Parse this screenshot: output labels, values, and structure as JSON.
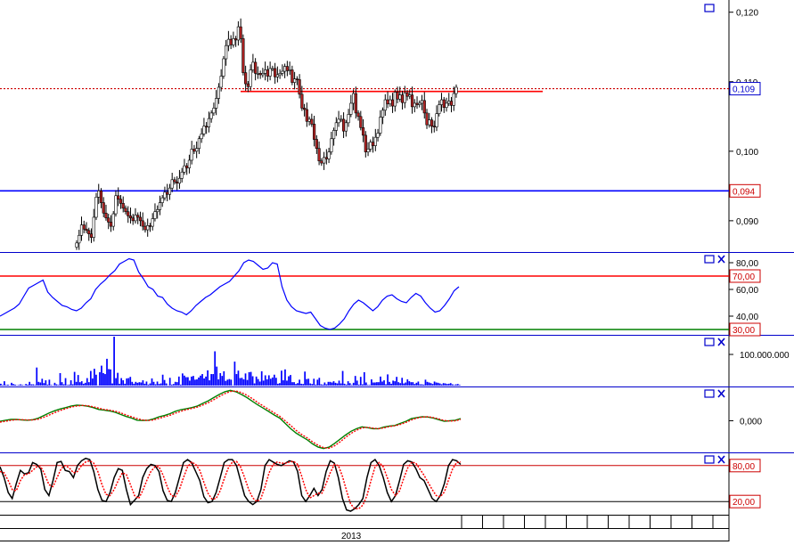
{
  "chart_data": [
    {
      "type": "candlestick",
      "panel": "price",
      "y_ticks": [
        "0,120",
        "0,110",
        "0,100",
        "0,090"
      ],
      "ylim": [
        0.0855,
        0.1215
      ],
      "current_price_label": "0,109",
      "current_price": 0.109,
      "support_label": "0,094",
      "support_level": 0.0943,
      "resistance_level": 0.1086,
      "colors": {
        "up": "#ffffff",
        "down": "#b22222",
        "support": "#0000ff",
        "resistance": "#ff0000",
        "current": "#cc0000"
      },
      "closes": [
        0.0868,
        0.0879,
        0.0894,
        0.0888,
        0.0886,
        0.0881,
        0.0876,
        0.0905,
        0.0934,
        0.0943,
        0.0926,
        0.0911,
        0.0904,
        0.0898,
        0.0892,
        0.091,
        0.0936,
        0.0931,
        0.0925,
        0.0918,
        0.0913,
        0.0907,
        0.0904,
        0.09,
        0.0908,
        0.0905,
        0.09,
        0.0892,
        0.0887,
        0.0893,
        0.0892,
        0.0903,
        0.0913,
        0.0916,
        0.0926,
        0.0933,
        0.0941,
        0.0938,
        0.0947,
        0.0959,
        0.0956,
        0.0954,
        0.0961,
        0.097,
        0.0979,
        0.0976,
        0.0987,
        0.1003,
        0.1,
        0.1004,
        0.1018,
        0.1025,
        0.1036,
        0.1035,
        0.1047,
        0.1055,
        0.1062,
        0.1076,
        0.1092,
        0.1108,
        0.1133,
        0.1152,
        0.1161,
        0.1153,
        0.1162,
        0.116,
        0.1179,
        0.1162,
        0.1113,
        0.1097,
        0.1093,
        0.1117,
        0.1128,
        0.1112,
        0.1112,
        0.111,
        0.1112,
        0.1117,
        0.1108,
        0.1119,
        0.1119,
        0.1107,
        0.111,
        0.1112,
        0.1115,
        0.1122,
        0.1116,
        0.1117,
        0.1099,
        0.1104,
        0.1103,
        0.1082,
        0.1062,
        0.106,
        0.1043,
        0.1046,
        0.1039,
        0.1017,
        0.1004,
        0.0986,
        0.0983,
        0.0991,
        0.0989,
        0.0999,
        0.1018,
        0.103,
        0.1041,
        0.1046,
        0.1046,
        0.1029,
        0.1041,
        0.1053,
        0.1069,
        0.1083,
        0.1055,
        0.105,
        0.1034,
        0.1023,
        0.0999,
        0.1003,
        0.1013,
        0.1008,
        0.102,
        0.1026,
        0.1049,
        0.1059,
        0.1074,
        0.1068,
        0.1074,
        0.1065,
        0.1085,
        0.1075,
        0.1081,
        0.107,
        0.1084,
        0.1079,
        0.1081,
        0.1064,
        0.1069,
        0.1067,
        0.1069,
        0.1073,
        0.1055,
        0.1038,
        0.1045,
        0.1036,
        0.1035,
        0.1054,
        0.1067,
        0.1074,
        0.1063,
        0.1069,
        0.1072,
        0.1066,
        0.1083,
        0.1092
      ]
    },
    {
      "type": "line",
      "panel": "rsi",
      "y_ticks": [
        "80,00",
        "60,00",
        "40,00"
      ],
      "ylim": [
        26,
        88
      ],
      "upper_label": "70,00",
      "upper_level": 70,
      "lower_label": "30,00",
      "lower_level": 30,
      "values": [
        40,
        42,
        44,
        46,
        49,
        55,
        61,
        63,
        65,
        67,
        58,
        54,
        51,
        48,
        47,
        45,
        44,
        46,
        50,
        53,
        60,
        64,
        67,
        71,
        74,
        79,
        81,
        83,
        82,
        73,
        68,
        62,
        60,
        55,
        54,
        49,
        46,
        44,
        43,
        41,
        44,
        48,
        51,
        54,
        56,
        59,
        62,
        64,
        66,
        70,
        74,
        80,
        82,
        81,
        78,
        75,
        76,
        80,
        79,
        62,
        52,
        47,
        44,
        43,
        42,
        43,
        38,
        33,
        31,
        30,
        31,
        34,
        38,
        44,
        49,
        52,
        50,
        47,
        44,
        47,
        52,
        55,
        56,
        53,
        51,
        50,
        54,
        57,
        55,
        50,
        46,
        43,
        44,
        48,
        53,
        59,
        62
      ],
      "colors": {
        "line": "#0000ff",
        "upper": "#ff0000",
        "lower": "#008000"
      }
    },
    {
      "type": "bar",
      "panel": "volume",
      "y_ticks": [
        "100.000.000"
      ],
      "ylim": [
        0,
        160000000
      ],
      "values": [
        6000000,
        2000000,
        14000000,
        2000000,
        3000000,
        1000000,
        9000000,
        5000000,
        3000000,
        1000000,
        2000000,
        4000000,
        2000000,
        1000000,
        5000000,
        3000000,
        12000000,
        4000000,
        4000000,
        2000000,
        58000000,
        12000000,
        10000000,
        22000000,
        8000000,
        17000000,
        3000000,
        19000000,
        2000000,
        1000000,
        9000000,
        4000000,
        2000000,
        40000000,
        11000000,
        4000000,
        24000000,
        2000000,
        3000000,
        17000000,
        4000000,
        44000000,
        12000000,
        34000000,
        11000000,
        14000000,
        6000000,
        9000000,
        24000000,
        11000000,
        47000000,
        23000000,
        54000000,
        35000000,
        1000000,
        43000000,
        64000000,
        40000000,
        37000000,
        86000000,
        53000000,
        52000000,
        7000000,
        157000000,
        24000000,
        41000000,
        6000000,
        24000000,
        17000000,
        6000000,
        23000000,
        24000000,
        28000000,
        12000000,
        6000000,
        12000000,
        9000000,
        11000000,
        10000000,
        17000000,
        6000000,
        13000000,
        3000000,
        7000000,
        23000000,
        12000000,
        4000000,
        13000000,
        5000000,
        7000000,
        35000000,
        18000000,
        7000000,
        1000000,
        25000000,
        3000000,
        5000000,
        12000000,
        11000000,
        29000000,
        3000000,
        39000000,
        32000000,
        27000000,
        27000000,
        16000000,
        29000000,
        31000000,
        19000000,
        20000000,
        26000000,
        32000000,
        37000000,
        23000000,
        29000000,
        49000000,
        17000000,
        37000000,
        37000000,
        110000000,
        61000000,
        20000000,
        40000000,
        31000000,
        46000000,
        15000000,
        19000000,
        21000000,
        19000000,
        1000000,
        77000000,
        37000000,
        48000000,
        24000000,
        25000000,
        20000000,
        39000000,
        18000000,
        43000000,
        44000000,
        30000000,
        7000000,
        29000000,
        21000000,
        13000000,
        46000000,
        16000000,
        33000000,
        20000000,
        33000000,
        22000000,
        26000000,
        35000000,
        25000000,
        6000000,
        8000000,
        48000000,
        17000000,
        52000000,
        16000000,
        30000000,
        34000000,
        11000000,
        11000000,
        5000000,
        8000000,
        19000000,
        6000000,
        5000000,
        45000000,
        21000000,
        22000000,
        7000000,
        5000000,
        22000000,
        3000000,
        19000000,
        25000000,
        4000000,
        3000000,
        10000000,
        4000000,
        12000000,
        12000000,
        10000000,
        14000000,
        9000000,
        7000000,
        16000000,
        7000000,
        47000000,
        6000000,
        3000000,
        14000000,
        8000000,
        2000000,
        9000000,
        31000000,
        16000000,
        3000000,
        28000000,
        4000000,
        43000000,
        10000000,
        2000000,
        2000000,
        20000000,
        10000000,
        10000000,
        11000000,
        11000000,
        29000000,
        13000000,
        17000000,
        4000000,
        36000000,
        12000000,
        6000000,
        16000000,
        14000000,
        28000000,
        11000000,
        8000000,
        25000000,
        7000000,
        10000000,
        20000000,
        14000000,
        11000000,
        11000000,
        5000000,
        9000000,
        13000000,
        4000000,
        4000000,
        3000000,
        19000000,
        12000000,
        10000000,
        8000000,
        5000000,
        13000000,
        10000000,
        9000000,
        7000000,
        4000000,
        8000000,
        7000000,
        5000000,
        6000000,
        8000000,
        4000000,
        2000000,
        4000000,
        5000000,
        2000000
      ],
      "colors": {
        "bar": "#0000ff"
      }
    },
    {
      "type": "line",
      "panel": "macd",
      "y_ticks": [
        "0,000"
      ],
      "ylim": [
        -1.2,
        1.3
      ],
      "series": [
        {
          "values": [
            -0.02,
            0.02,
            0.05,
            0.05,
            0.03,
            0.02,
            0.04,
            0.1,
            0.2,
            0.3,
            0.38,
            0.45,
            0.5,
            0.56,
            0.59,
            0.58,
            0.55,
            0.5,
            0.43,
            0.4,
            0.37,
            0.32,
            0.24,
            0.16,
            0.1,
            0.02,
            0.01,
            0.02,
            0.07,
            0.15,
            0.2,
            0.27,
            0.36,
            0.42,
            0.46,
            0.5,
            0.56,
            0.66,
            0.76,
            0.88,
            1.0,
            1.1,
            1.15,
            1.1,
            1.0,
            0.88,
            0.74,
            0.6,
            0.48,
            0.35,
            0.22,
            0.1,
            -0.1,
            -0.3,
            -0.47,
            -0.6,
            -0.72,
            -0.88,
            -1.0,
            -1.05,
            -1.0,
            -0.86,
            -0.7,
            -0.54,
            -0.4,
            -0.3,
            -0.23,
            -0.26,
            -0.3,
            -0.3,
            -0.24,
            -0.2,
            -0.18,
            -0.1,
            -0.02,
            0.08,
            0.12,
            0.15,
            0.14,
            0.1,
            0.04,
            -0.02,
            0.0,
            0.02,
            0.08
          ],
          "color": "#008000"
        },
        {
          "values": [
            -0.05,
            -0.02,
            0.02,
            0.04,
            0.04,
            0.03,
            0.03,
            0.06,
            0.13,
            0.22,
            0.31,
            0.39,
            0.46,
            0.52,
            0.56,
            0.58,
            0.57,
            0.53,
            0.48,
            0.43,
            0.4,
            0.36,
            0.3,
            0.22,
            0.15,
            0.08,
            0.03,
            0.01,
            0.03,
            0.09,
            0.15,
            0.21,
            0.29,
            0.36,
            0.42,
            0.47,
            0.52,
            0.6,
            0.69,
            0.8,
            0.92,
            1.03,
            1.11,
            1.13,
            1.07,
            0.97,
            0.84,
            0.69,
            0.56,
            0.43,
            0.3,
            0.17,
            0.0,
            -0.18,
            -0.37,
            -0.52,
            -0.65,
            -0.8,
            -0.93,
            -1.02,
            -1.04,
            -0.95,
            -0.8,
            -0.63,
            -0.48,
            -0.36,
            -0.27,
            -0.25,
            -0.28,
            -0.3,
            -0.27,
            -0.22,
            -0.19,
            -0.14,
            -0.06,
            0.03,
            0.1,
            0.14,
            0.15,
            0.12,
            0.07,
            0.01,
            -0.01,
            0.0,
            0.05
          ],
          "color": "#ff0000"
        }
      ]
    },
    {
      "type": "line",
      "panel": "stochastic",
      "y_ticks": [],
      "ylim": [
        -2,
        102
      ],
      "upper_label": "80,00",
      "upper_level": 80,
      "lower_label": "20,00",
      "lower_level": 20,
      "series": [
        {
          "values": [
            78,
            60,
            35,
            25,
            50,
            72,
            66,
            68,
            85,
            82,
            74,
            40,
            30,
            55,
            85,
            87,
            72,
            70,
            60,
            80,
            88,
            92,
            90,
            70,
            40,
            22,
            20,
            35,
            60,
            75,
            72,
            40,
            15,
            22,
            30,
            60,
            75,
            82,
            80,
            70,
            38,
            22,
            20,
            35,
            60,
            85,
            90,
            85,
            70,
            55,
            28,
            18,
            20,
            35,
            60,
            85,
            90,
            90,
            80,
            55,
            30,
            20,
            15,
            20,
            40,
            80,
            90,
            86,
            82,
            80,
            84,
            88,
            86,
            70,
            30,
            20,
            30,
            42,
            30,
            40,
            70,
            88,
            84,
            60,
            25,
            6,
            4,
            8,
            15,
            25,
            60,
            85,
            90,
            80,
            60,
            35,
            20,
            30,
            55,
            82,
            88,
            86,
            75,
            60,
            55,
            40,
            25,
            20,
            30,
            50,
            80,
            90,
            88,
            82
          ],
          "color": "#000000"
        },
        {
          "values": [
            70,
            68,
            55,
            40,
            38,
            55,
            65,
            66,
            72,
            78,
            78,
            65,
            48,
            45,
            60,
            75,
            80,
            76,
            68,
            70,
            80,
            86,
            88,
            84,
            70,
            48,
            32,
            30,
            40,
            55,
            68,
            65,
            48,
            30,
            25,
            38,
            55,
            70,
            78,
            78,
            64,
            45,
            30,
            28,
            40,
            60,
            78,
            86,
            82,
            72,
            52,
            34,
            24,
            25,
            38,
            58,
            76,
            86,
            87,
            78,
            60,
            40,
            26,
            20,
            25,
            45,
            68,
            82,
            86,
            84,
            84,
            86,
            87,
            82,
            62,
            40,
            26,
            30,
            34,
            34,
            50,
            68,
            82,
            80,
            62,
            38,
            16,
            8,
            8,
            14,
            30,
            55,
            78,
            85,
            78,
            60,
            40,
            30,
            38,
            58,
            76,
            86,
            84,
            74,
            64,
            52,
            40,
            30,
            28,
            36,
            56,
            74,
            85,
            86
          ],
          "color": "#ff0000"
        }
      ]
    },
    {
      "type": "axis",
      "panel": "date",
      "labels": [
        "2013"
      ]
    }
  ]
}
